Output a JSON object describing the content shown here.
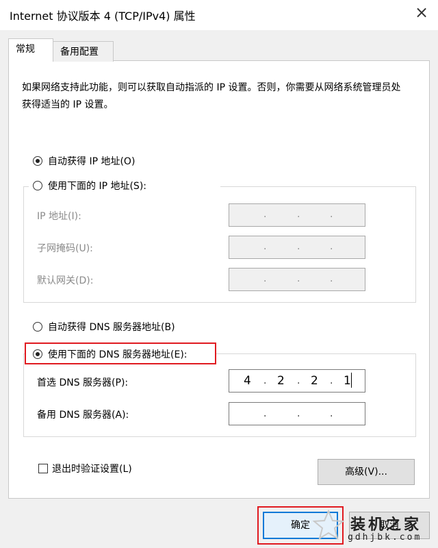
{
  "window": {
    "title": "Internet 协议版本 4 (TCP/IPv4) 属性",
    "close_glyph": "×"
  },
  "tabs": [
    {
      "label": "常规",
      "active": true
    },
    {
      "label": "备用配置",
      "active": false
    }
  ],
  "description": "如果网络支持此功能，则可以获取自动指派的 IP 设置。否则，你需要从网络系统管理员处获得适当的 IP 设置。",
  "ip_section": {
    "auto_label": "自动获得 IP 地址(O)",
    "auto_selected": true,
    "manual_label": "使用下面的 IP 地址(S):",
    "fields": [
      {
        "label": "IP 地址(I):",
        "octets": [
          "",
          "",
          "",
          ""
        ]
      },
      {
        "label": "子网掩码(U):",
        "octets": [
          "",
          "",
          "",
          ""
        ]
      },
      {
        "label": "默认网关(D):",
        "octets": [
          "",
          "",
          "",
          ""
        ]
      }
    ]
  },
  "dns_section": {
    "auto_label": "自动获得 DNS 服务器地址(B)",
    "manual_label": "使用下面的 DNS 服务器地址(E):",
    "manual_selected": true,
    "fields": [
      {
        "label": "首选 DNS 服务器(P):",
        "octets": [
          "4",
          "2",
          "2",
          "1"
        ]
      },
      {
        "label": "备用 DNS 服务器(A):",
        "octets": [
          "",
          "",
          "",
          ""
        ]
      }
    ]
  },
  "validate_label": "退出时验证设置(L)",
  "advanced_label": "高级(V)...",
  "ok_label": "确定",
  "cancel_label": "取消",
  "watermark": {
    "text": "装机之家",
    "url": "gdhjbk.com"
  },
  "colors": {
    "highlight": "#e0191f",
    "accent": "#0078d7"
  }
}
